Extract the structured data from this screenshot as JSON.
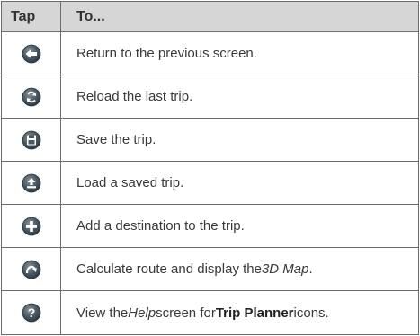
{
  "table": {
    "headers": {
      "tap": "Tap",
      "to": "To..."
    },
    "rows": [
      {
        "icon": "back-arrow-icon",
        "text": "Return to the previous screen."
      },
      {
        "icon": "reload-icon",
        "text": "Reload the last trip."
      },
      {
        "icon": "save-icon",
        "text": "Save the trip."
      },
      {
        "icon": "load-icon",
        "text": "Load a saved trip."
      },
      {
        "icon": "add-icon",
        "text": "Add a destination to the trip."
      },
      {
        "icon": "calculate-route-icon",
        "text_before": "Calculate route and display the ",
        "text_em": "3D Map",
        "text_after": "."
      },
      {
        "icon": "help-icon",
        "text_before": "View the ",
        "text_em": "Help",
        "text_middle": " screen for ",
        "text_bold": "Trip Planner",
        "text_after": " icons."
      }
    ]
  },
  "colors": {
    "header_bg": "#d6d6d6",
    "border": "#6b6b6b",
    "icon_dark": "#3c4a55",
    "text": "#3a3a3a"
  }
}
